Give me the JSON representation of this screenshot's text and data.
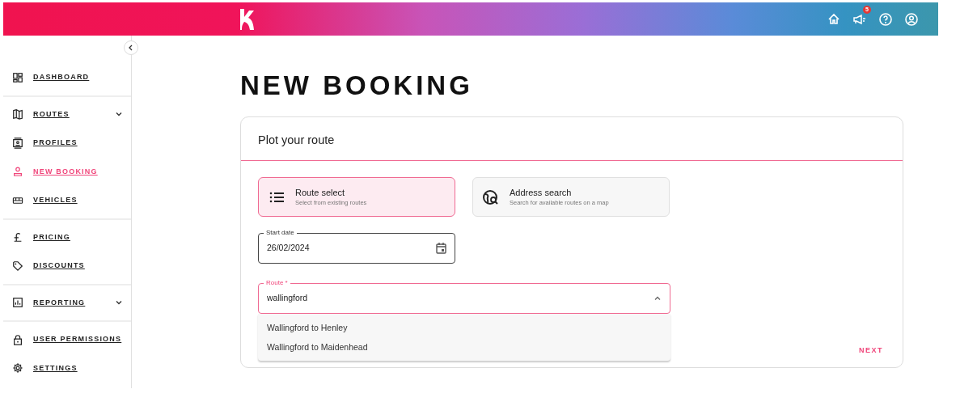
{
  "header": {
    "icons": [
      {
        "kind": "home"
      },
      {
        "kind": "announcement",
        "badge": "5"
      },
      {
        "kind": "help"
      },
      {
        "kind": "account"
      }
    ]
  },
  "sidebar": {
    "groups": [
      [
        {
          "label": "DASHBOARD",
          "selected": false,
          "expandable": false
        }
      ],
      [
        {
          "label": "ROUTES",
          "selected": false,
          "expandable": true
        },
        {
          "label": "PROFILES",
          "selected": false,
          "expandable": false
        },
        {
          "label": "NEW BOOKING",
          "selected": true,
          "expandable": false
        },
        {
          "label": "VEHICLES",
          "selected": false,
          "expandable": false
        }
      ],
      [
        {
          "label": "PRICING",
          "selected": false,
          "expandable": false
        },
        {
          "label": "DISCOUNTS",
          "selected": false,
          "expandable": false
        }
      ],
      [
        {
          "label": "REPORTING",
          "selected": false,
          "expandable": true
        }
      ],
      [
        {
          "label": "USER PERMISSIONS",
          "selected": false,
          "expandable": false
        },
        {
          "label": "SETTINGS",
          "selected": false,
          "expandable": false
        }
      ]
    ]
  },
  "page_title": "NEW BOOKING",
  "card": {
    "title": "Plot your route",
    "options": [
      {
        "title": "Route select",
        "subtitle": "Select from existing routes",
        "selected": true
      },
      {
        "title": "Address search",
        "subtitle": "Search for available routes on a map",
        "selected": false
      }
    ],
    "start_date": {
      "label": "Start date",
      "value": "26/02/2024"
    },
    "route": {
      "label": "Route *",
      "value": "wallingford",
      "focused": true,
      "expanded": true,
      "options": [
        "Wallingford to Henley",
        "Wallingford to Maidenhead"
      ]
    },
    "next_button": "NEXT"
  }
}
